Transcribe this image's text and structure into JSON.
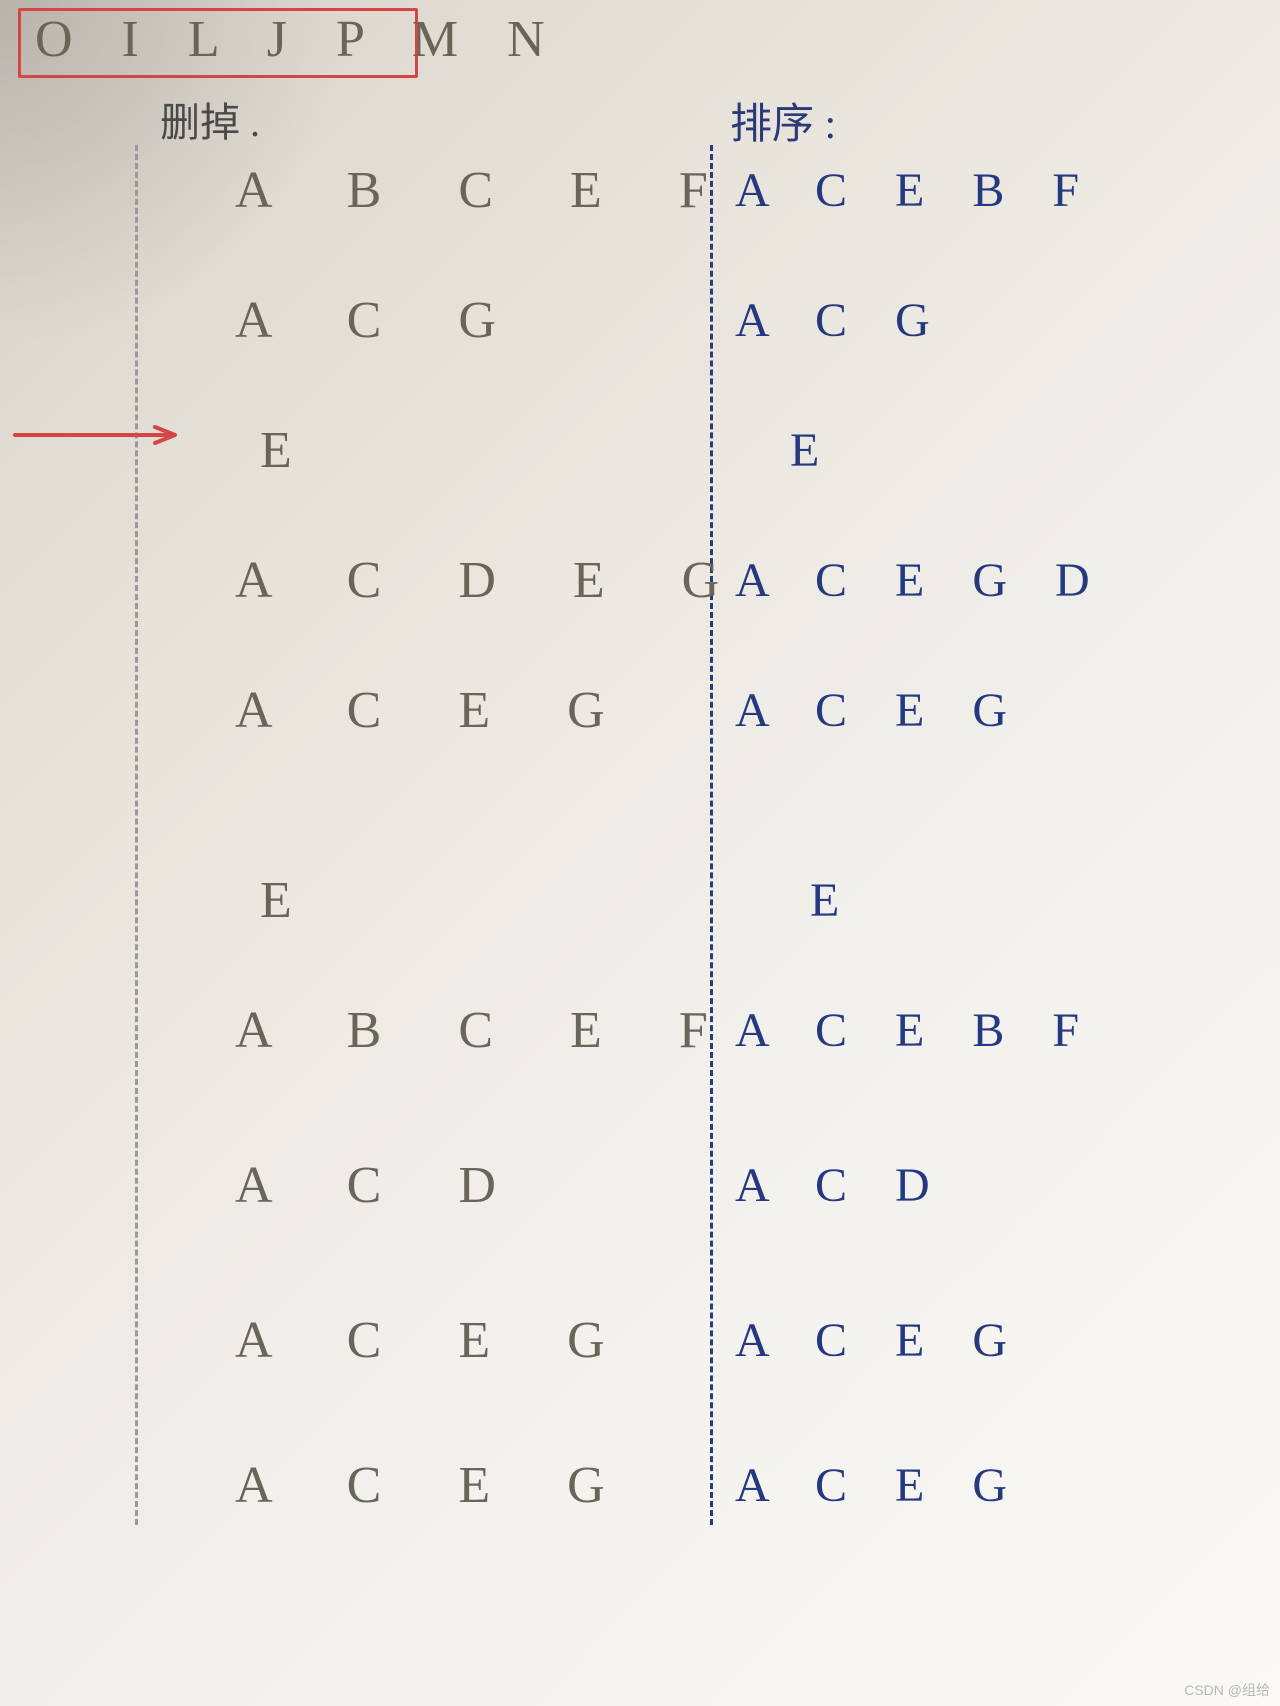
{
  "top_box": "O I L J P M N",
  "headers": {
    "left": "删掉 .",
    "right": "排序 :"
  },
  "rows": [
    {
      "left": "A B C E F",
      "right": "A C E B F"
    },
    {
      "left": "A C G",
      "right": "A C G"
    },
    {
      "left": "E",
      "right": "E"
    },
    {
      "left": "A C D E G",
      "right": "A C E G D"
    },
    {
      "left": "A C E G",
      "right": "A C E G"
    },
    {
      "left": "E",
      "right": "E"
    },
    {
      "left": "A B C E F",
      "right": "A C E B F"
    },
    {
      "left": "A C D",
      "right": "A C D"
    },
    {
      "left": "A C E G",
      "right": "A C E G"
    },
    {
      "left": "A C E G",
      "right": "A C E G"
    }
  ],
  "watermark": "CSDN @组给"
}
